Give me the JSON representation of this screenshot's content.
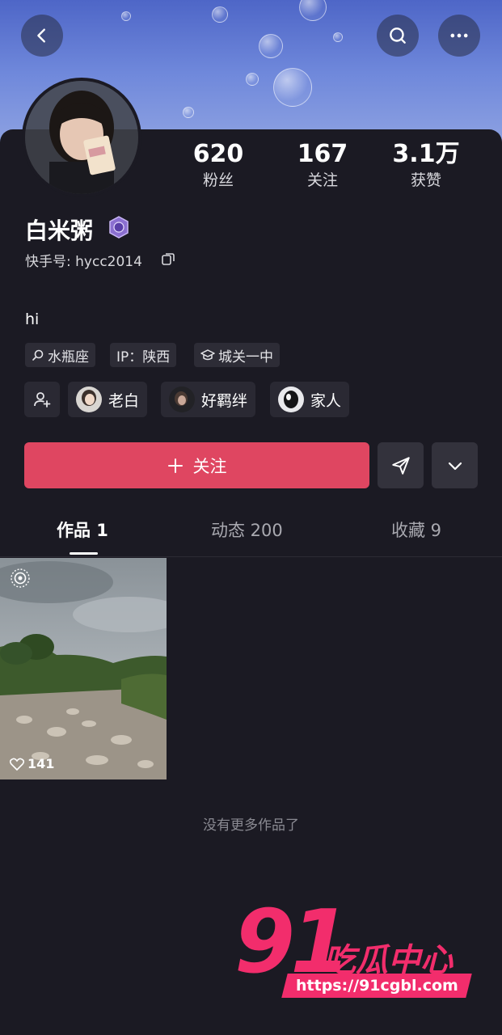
{
  "header": {
    "back_icon": "chevron-left-icon",
    "search_icon": "search-icon",
    "more_icon": "more-horizontal-icon"
  },
  "profile": {
    "name": "白米粥",
    "kuaishou_id": "快手号: hycc2014",
    "bio": "hi",
    "stats": [
      {
        "num": "620",
        "label": "粉丝"
      },
      {
        "num": "167",
        "label": "关注"
      },
      {
        "num": "3.1万",
        "label": "获赞"
      }
    ],
    "tags": [
      {
        "icon": "search-small-icon",
        "label": "水瓶座"
      },
      {
        "icon": "",
        "label": "IP：陕西"
      },
      {
        "icon": "graduation-cap-icon",
        "label": "城关一中"
      }
    ],
    "relations": [
      {
        "label": "老白"
      },
      {
        "label": "好羁绊"
      },
      {
        "label": "家人"
      }
    ]
  },
  "actions": {
    "follow_label": "关注",
    "accent_color": "#df4661"
  },
  "tabs": [
    {
      "label": "作品 1",
      "active": true
    },
    {
      "label": "动态 200",
      "active": false
    },
    {
      "label": "收藏 9",
      "active": false
    }
  ],
  "works": [
    {
      "likes": "141"
    }
  ],
  "no_more_text": "没有更多作品了",
  "watermark": {
    "number": "91",
    "text": "吃瓜中心",
    "url": "https://91cgbl.com"
  }
}
